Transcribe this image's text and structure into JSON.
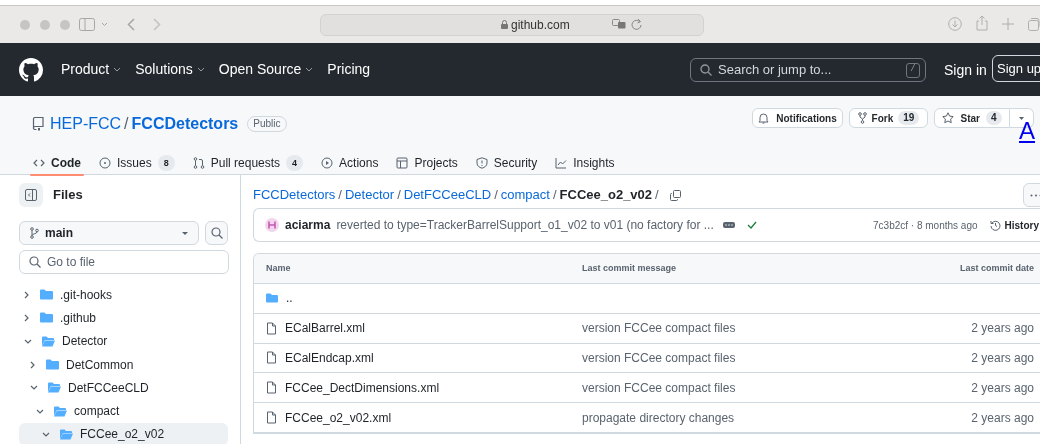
{
  "browser": {
    "url": "github.com"
  },
  "header": {
    "nav": [
      {
        "label": "Product",
        "dropdown": true
      },
      {
        "label": "Solutions",
        "dropdown": true
      },
      {
        "label": "Open Source",
        "dropdown": true
      },
      {
        "label": "Pricing",
        "dropdown": false
      }
    ],
    "search": {
      "placeholder": "Search or jump to...",
      "shortcut": "/"
    },
    "sign_in": "Sign in",
    "sign_up": "Sign up"
  },
  "repo": {
    "owner": "HEP-FCC",
    "separator": "/",
    "name": "FCCDetectors",
    "visibility": "Public",
    "notifications": "Notifications",
    "fork": {
      "label": "Fork",
      "count": "19"
    },
    "star": {
      "label": "Star",
      "count": "4"
    },
    "overlay_link": "A"
  },
  "tabs": [
    {
      "kind": "code",
      "label": "Code",
      "selected": true
    },
    {
      "kind": "issues",
      "label": "Issues",
      "count": "8",
      "selected": false
    },
    {
      "kind": "pulls",
      "label": "Pull requests",
      "count": "4",
      "selected": false
    },
    {
      "kind": "actions",
      "label": "Actions",
      "selected": false
    },
    {
      "kind": "projects",
      "label": "Projects",
      "selected": false
    },
    {
      "kind": "security",
      "label": "Security",
      "selected": false
    },
    {
      "kind": "insights",
      "label": "Insights",
      "selected": false
    }
  ],
  "sidebar": {
    "title": "Files",
    "branch": "main",
    "search": {
      "placeholder": "Go to file"
    },
    "tree": [
      {
        "name": ".git-hooks",
        "expanded": false,
        "selected": false
      },
      {
        "name": ".github",
        "expanded": false,
        "selected": false
      },
      {
        "name": "Detector",
        "expanded": true,
        "selected": false,
        "children": [
          {
            "name": "DetCommon",
            "expanded": false,
            "selected": false
          },
          {
            "name": "DetFCCeeCLD",
            "expanded": true,
            "selected": false,
            "children": [
              {
                "name": "compact",
                "expanded": true,
                "selected": false,
                "children": [
                  {
                    "name": "FCCee_o2_v02",
                    "expanded": true,
                    "selected": true
                  }
                ]
              }
            ]
          }
        ]
      }
    ]
  },
  "breadcrumb": {
    "links": [
      "FCCDetectors",
      "Detector",
      "DetFCCeeCLD",
      "compact"
    ],
    "current": "FCCee_o2_v02",
    "separator": "/"
  },
  "commit": {
    "author": "aciarma",
    "message": "reverted to type=TrackerBarrelSupport_o1_v02 to v01 (no factory for ...",
    "checks_passed": true,
    "hash_time": "7c3b2cf · 8 months ago",
    "history": "History"
  },
  "table": {
    "columns": [
      "Name",
      "Last commit message",
      "Last commit date"
    ],
    "rows": [
      {
        "kind": "parent",
        "name": ".."
      },
      {
        "kind": "file",
        "name": "ECalBarrel.xml",
        "message": "version FCCee compact files",
        "date": "2 years ago"
      },
      {
        "kind": "file",
        "name": "ECalEndcap.xml",
        "message": "version FCCee compact files",
        "date": "2 years ago"
      },
      {
        "kind": "file",
        "name": "FCCee_DectDimensions.xml",
        "message": "version FCCee compact files",
        "date": "2 years ago"
      },
      {
        "kind": "file",
        "name": "FCCee_o2_v02.xml",
        "message": "propagate directory changes",
        "date": "2 years ago"
      }
    ]
  }
}
